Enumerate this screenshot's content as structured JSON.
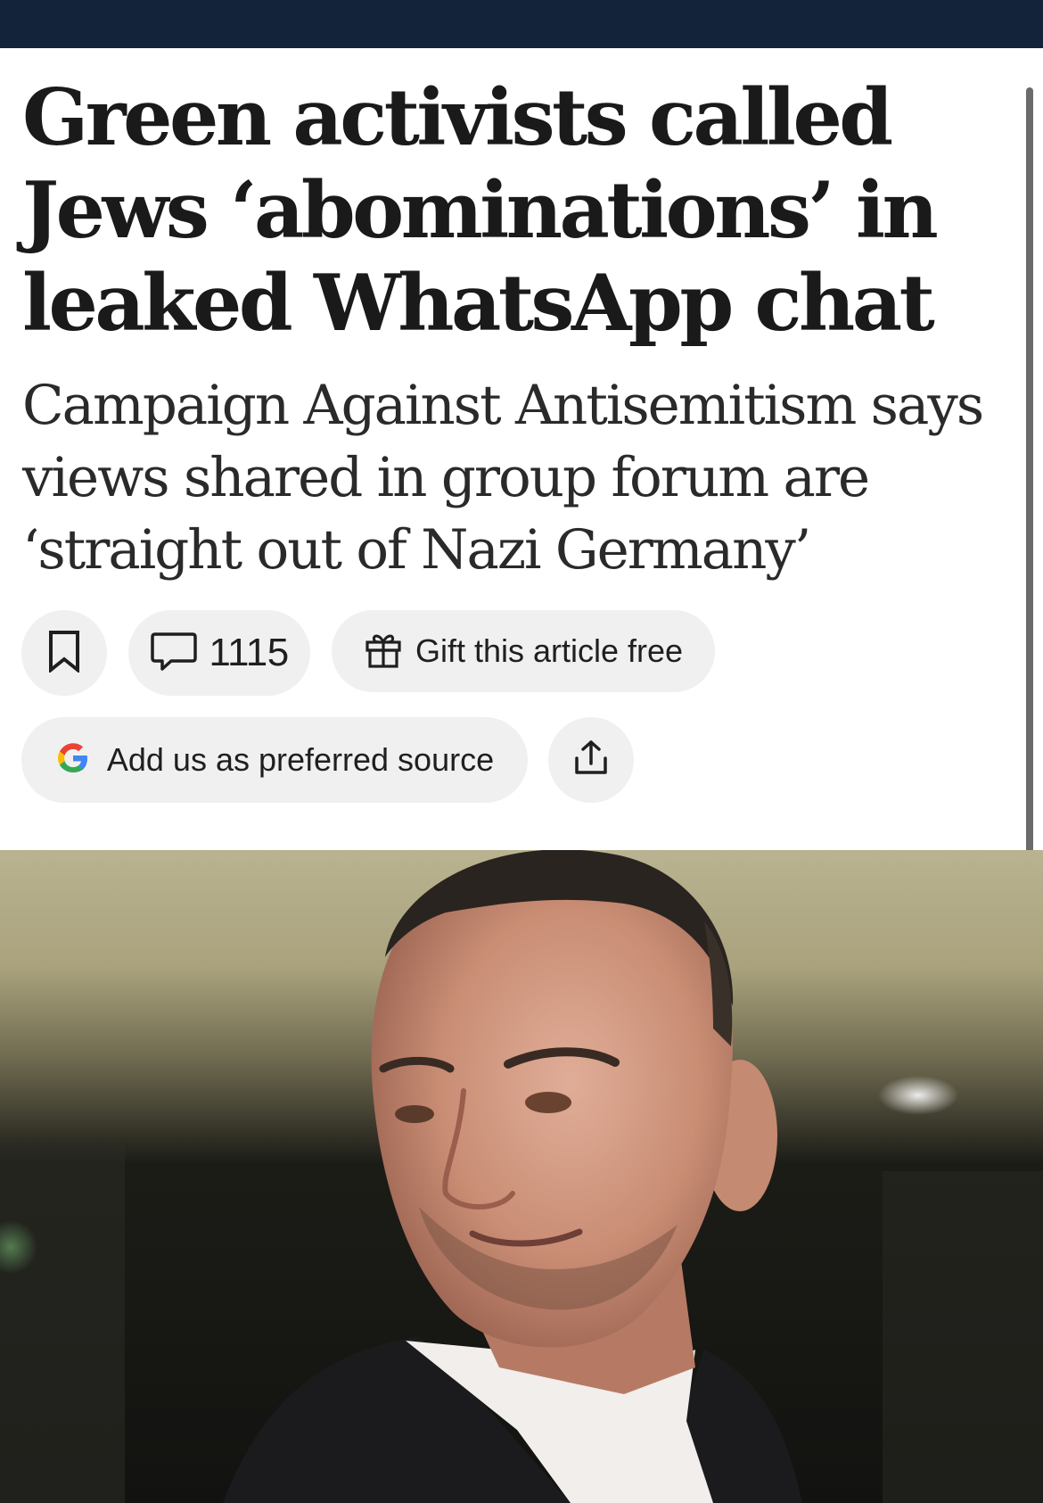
{
  "article": {
    "headline": "Green activists called Jews ‘abominations’ in leaked WhatsApp chat",
    "standfirst": "Campaign Against Antisemitism says views shared in group forum are ‘straight out of Nazi Germany’"
  },
  "actions": {
    "comment_count": "1115",
    "gift_label": "Gift this article free",
    "preferred_source_label": "Add us as preferred source"
  },
  "icons": {
    "bookmark": "bookmark-icon",
    "comment": "comment-bubble-icon",
    "gift": "gift-icon",
    "google": "google-logo-icon",
    "share": "share-icon"
  },
  "colors": {
    "topbar": "#13243a",
    "pill_bg": "#f0f0f0",
    "text": "#1a1a1a"
  }
}
